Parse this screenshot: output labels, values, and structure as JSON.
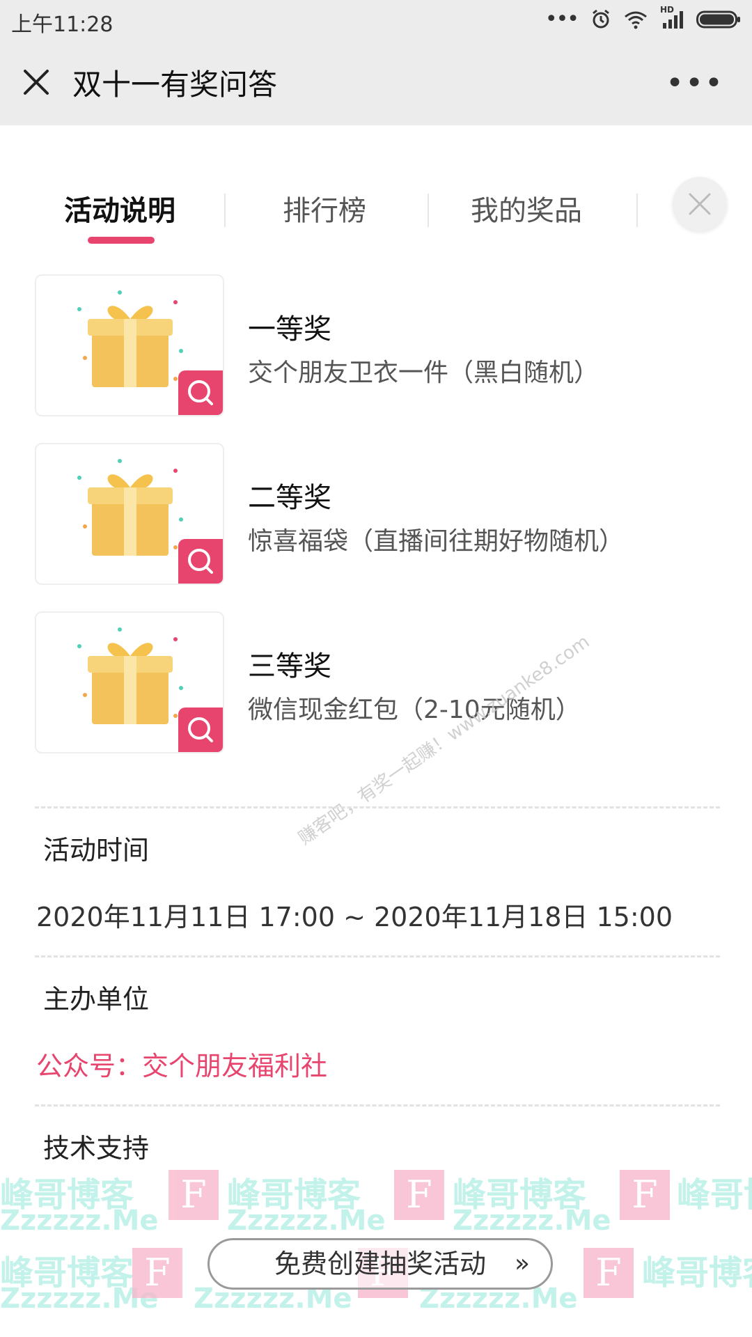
{
  "status_bar": {
    "time": "上午11:28",
    "icons": [
      "more-dots-icon",
      "alarm-icon",
      "wifi-icon",
      "signal-hd-icon",
      "battery-icon"
    ],
    "signal_label": "HD"
  },
  "nav": {
    "title": "双十一有奖问答",
    "more_label": "•••"
  },
  "tabs": [
    {
      "label": "活动说明",
      "active": true
    },
    {
      "label": "排行榜",
      "active": false
    },
    {
      "label": "我的奖品",
      "active": false
    }
  ],
  "prizes": [
    {
      "name": "一等奖",
      "desc": "交个朋友卫衣一件（黑白随机）"
    },
    {
      "name": "二等奖",
      "desc": "惊喜福袋（直播间往期好物随机）"
    },
    {
      "name": "三等奖",
      "desc": "微信现金红包（2-10元随机）"
    }
  ],
  "sections": {
    "time_title": "活动时间",
    "time_value": "2020年11月11日 17:00 ~ 2020年11月18日 15:00",
    "org_title": "主办单位",
    "org_value": "公众号：交个朋友福利社",
    "support_title": "技术支持"
  },
  "create_button": {
    "label": "免费创建抽奖活动",
    "arrow": "»"
  },
  "watermarks": {
    "brand": "峰哥博客",
    "site": "Zzzzzz.Me",
    "box_letter": "F",
    "diagonal": "赚客吧，有奖一起赚！www.zuanke8.com"
  },
  "colors": {
    "accent": "#e8456e",
    "bar_bg": "#ececec",
    "highlight": "#fbe1e8"
  }
}
